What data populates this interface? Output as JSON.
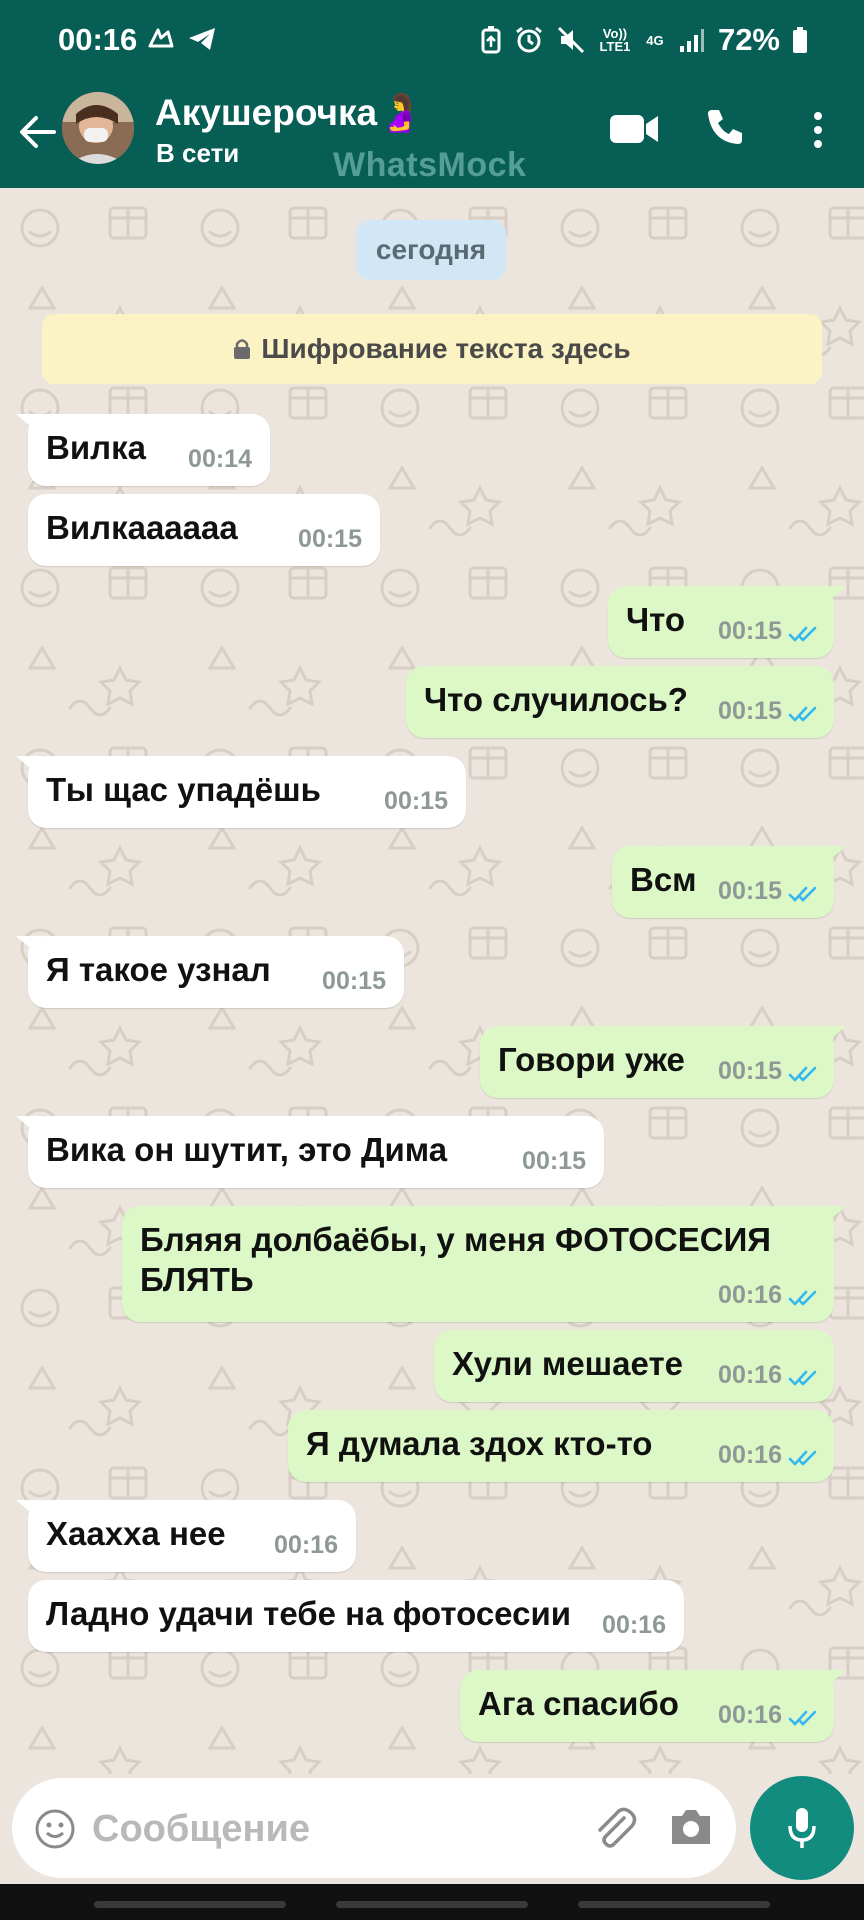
{
  "status_bar": {
    "time": "00:16",
    "volte": "Vo)) LTE1",
    "network": "4G",
    "battery": "72%"
  },
  "header": {
    "contact_name": "Акушерочка🤰",
    "contact_status": "В сети",
    "watermark": "WhatsMock",
    "icons": [
      "back-arrow-icon",
      "video-call-icon",
      "phone-icon",
      "more-vert-icon"
    ]
  },
  "chat": {
    "date_chip": "сегодня",
    "encryption_notice": "Шифрование текста здесь",
    "messages": [
      {
        "dir": "in",
        "text": "Вилка",
        "time": "00:14"
      },
      {
        "dir": "in",
        "text": "Вилкаааааа",
        "time": "00:15"
      },
      {
        "dir": "out",
        "text": "Что",
        "time": "00:15",
        "read": true
      },
      {
        "dir": "out",
        "text": "Что случилось?",
        "time": "00:15",
        "read": true
      },
      {
        "dir": "in",
        "text": "Ты щас упадёшь",
        "time": "00:15"
      },
      {
        "dir": "out",
        "text": "Всм",
        "time": "00:15",
        "read": true
      },
      {
        "dir": "in",
        "text": "Я такое узнал",
        "time": "00:15"
      },
      {
        "dir": "out",
        "text": "Говори уже",
        "time": "00:15",
        "read": true
      },
      {
        "dir": "in",
        "text": "Вика он шутит, это Дима",
        "time": "00:15"
      },
      {
        "dir": "out",
        "text": "Бляяя долбаёбы, у меня ФОТОСЕСИЯ БЛЯТЬ",
        "time": "00:16",
        "read": true
      },
      {
        "dir": "out",
        "text": "Хули мешаете",
        "time": "00:16",
        "read": true
      },
      {
        "dir": "out",
        "text": "Я думала здох кто-то",
        "time": "00:16",
        "read": true
      },
      {
        "dir": "in",
        "text": "Хаахха нее",
        "time": "00:16"
      },
      {
        "dir": "in",
        "text": "Ладно удачи тебе на фотосесии",
        "time": "00:16"
      },
      {
        "dir": "out",
        "text": "Ага спасибо",
        "time": "00:16",
        "read": true
      }
    ]
  },
  "input_bar": {
    "placeholder": "Сообщение",
    "icons": [
      "emoji-icon",
      "attach-icon",
      "camera-icon",
      "mic-icon"
    ]
  },
  "colors": {
    "header_bg": "#075E54",
    "chat_bg": "#ECE5DD",
    "outgoing_bubble": "#DCF8C6",
    "incoming_bubble": "#FFFFFF",
    "read_ticks": "#34B7F1",
    "mic_button": "#128C7E"
  }
}
